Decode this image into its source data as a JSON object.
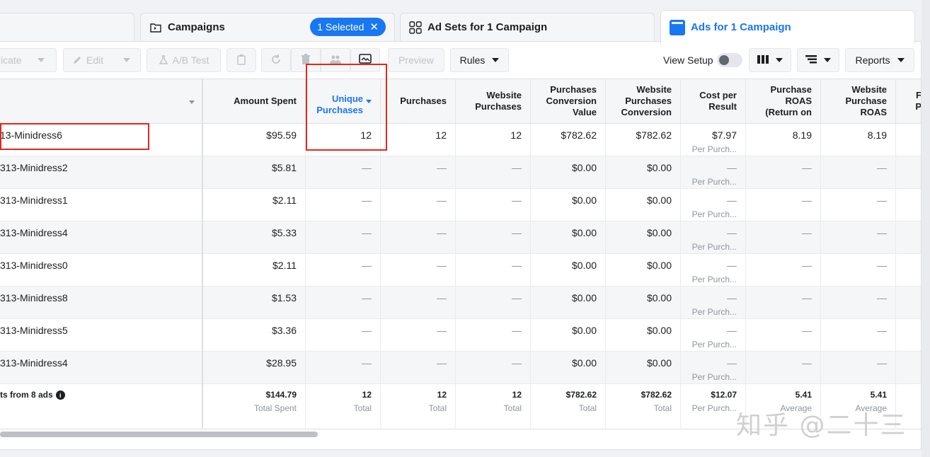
{
  "tabs": {
    "campaigns": {
      "label": "Campaigns",
      "selected_label": "1 Selected",
      "icon": "folder-icon"
    },
    "adsets": {
      "label": "Ad Sets for 1 Campaign",
      "icon": "grid-icon"
    },
    "ads": {
      "label": "Ads for 1 Campaign",
      "icon": "ad-icon"
    }
  },
  "toolbar": {
    "duplicate_label": "icate",
    "edit_label": "Edit",
    "ab_test_label": "A/B Test",
    "preview_label": "Preview",
    "rules_label": "Rules",
    "view_setup_label": "View Setup",
    "reports_label": "Reports"
  },
  "columns": [
    {
      "key": "amount_spent",
      "label": "Amount Spent"
    },
    {
      "key": "unique_purchases",
      "label": "Unique Purchases"
    },
    {
      "key": "purchases",
      "label": "Purchases"
    },
    {
      "key": "website_purchases",
      "label": "Website Purchases"
    },
    {
      "key": "purchases_conversion_value",
      "label": "Purchases Conversion Value"
    },
    {
      "key": "website_purchases_conversion",
      "label": "Website Purchases Conversion"
    },
    {
      "key": "cost_per_result",
      "label": "Cost per Result"
    },
    {
      "key": "purchase_roas",
      "label": "Purchase ROAS (Return on"
    },
    {
      "key": "website_purchase_roas",
      "label": "Website Purchase ROAS"
    },
    {
      "key": "extra",
      "label": "F P"
    }
  ],
  "rows": [
    {
      "name": "13-Minidress6",
      "amount_spent": "$95.59",
      "unique_purchases": "12",
      "purchases": "12",
      "website_purchases": "12",
      "purchases_conversion_value": "$782.62",
      "website_purchases_conversion": "$782.62",
      "cost_per_result": "$7.97",
      "cost_sub": "Per Purch...",
      "purchase_roas": "8.19",
      "website_purchase_roas": "8.19"
    },
    {
      "name": "313-Minidress2",
      "amount_spent": "$5.81",
      "unique_purchases": "—",
      "purchases": "—",
      "website_purchases": "—",
      "purchases_conversion_value": "$0.00",
      "website_purchases_conversion": "$0.00",
      "cost_per_result": "—",
      "cost_sub": "Per Purch...",
      "purchase_roas": "—",
      "website_purchase_roas": "—"
    },
    {
      "name": "313-Minidress1",
      "amount_spent": "$2.11",
      "unique_purchases": "—",
      "purchases": "—",
      "website_purchases": "—",
      "purchases_conversion_value": "$0.00",
      "website_purchases_conversion": "$0.00",
      "cost_per_result": "—",
      "cost_sub": "Per Purch...",
      "purchase_roas": "—",
      "website_purchase_roas": "—"
    },
    {
      "name": "313-Minidress4",
      "amount_spent": "$5.33",
      "unique_purchases": "—",
      "purchases": "—",
      "website_purchases": "—",
      "purchases_conversion_value": "$0.00",
      "website_purchases_conversion": "$0.00",
      "cost_per_result": "—",
      "cost_sub": "Per Purch...",
      "purchase_roas": "—",
      "website_purchase_roas": "—"
    },
    {
      "name": "313-Minidress0",
      "amount_spent": "$2.11",
      "unique_purchases": "—",
      "purchases": "—",
      "website_purchases": "—",
      "purchases_conversion_value": "$0.00",
      "website_purchases_conversion": "$0.00",
      "cost_per_result": "—",
      "cost_sub": "Per Purch...",
      "purchase_roas": "—",
      "website_purchase_roas": "—"
    },
    {
      "name": "313-Minidress8",
      "amount_spent": "$1.53",
      "unique_purchases": "—",
      "purchases": "—",
      "website_purchases": "—",
      "purchases_conversion_value": "$0.00",
      "website_purchases_conversion": "$0.00",
      "cost_per_result": "—",
      "cost_sub": "Per Purch...",
      "purchase_roas": "—",
      "website_purchase_roas": "—"
    },
    {
      "name": "313-Minidress5",
      "amount_spent": "$3.36",
      "unique_purchases": "—",
      "purchases": "—",
      "website_purchases": "—",
      "purchases_conversion_value": "$0.00",
      "website_purchases_conversion": "$0.00",
      "cost_per_result": "—",
      "cost_sub": "Per Purch...",
      "purchase_roas": "—",
      "website_purchase_roas": "—"
    },
    {
      "name": "313-Minidress4",
      "amount_spent": "$28.95",
      "unique_purchases": "—",
      "purchases": "—",
      "website_purchases": "—",
      "purchases_conversion_value": "$0.00",
      "website_purchases_conversion": "$0.00",
      "cost_per_result": "—",
      "cost_sub": "Per Purch...",
      "purchase_roas": "—",
      "website_purchase_roas": "—"
    }
  ],
  "totals": {
    "name": "ts from 8 ads",
    "amount_spent": "$144.79",
    "amount_spent_sub": "Total Spent",
    "unique_purchases": "12",
    "unique_purchases_sub": "Total",
    "purchases": "12",
    "purchases_sub": "Total",
    "website_purchases": "12",
    "website_purchases_sub": "Total",
    "purchases_conversion_value": "$782.62",
    "purchases_conversion_value_sub": "Total",
    "website_purchases_conversion": "$782.62",
    "website_purchases_conversion_sub": "Total",
    "cost_per_result": "$12.07",
    "cost_per_result_sub": "Per Purch...",
    "purchase_roas": "5.41",
    "purchase_roas_sub": "Average",
    "website_purchase_roas": "5.41",
    "website_purchase_roas_sub": "Average"
  },
  "watermark": "知乎 @二十三",
  "colors": {
    "accent": "#1877f2",
    "annotation": "#e0281e"
  }
}
